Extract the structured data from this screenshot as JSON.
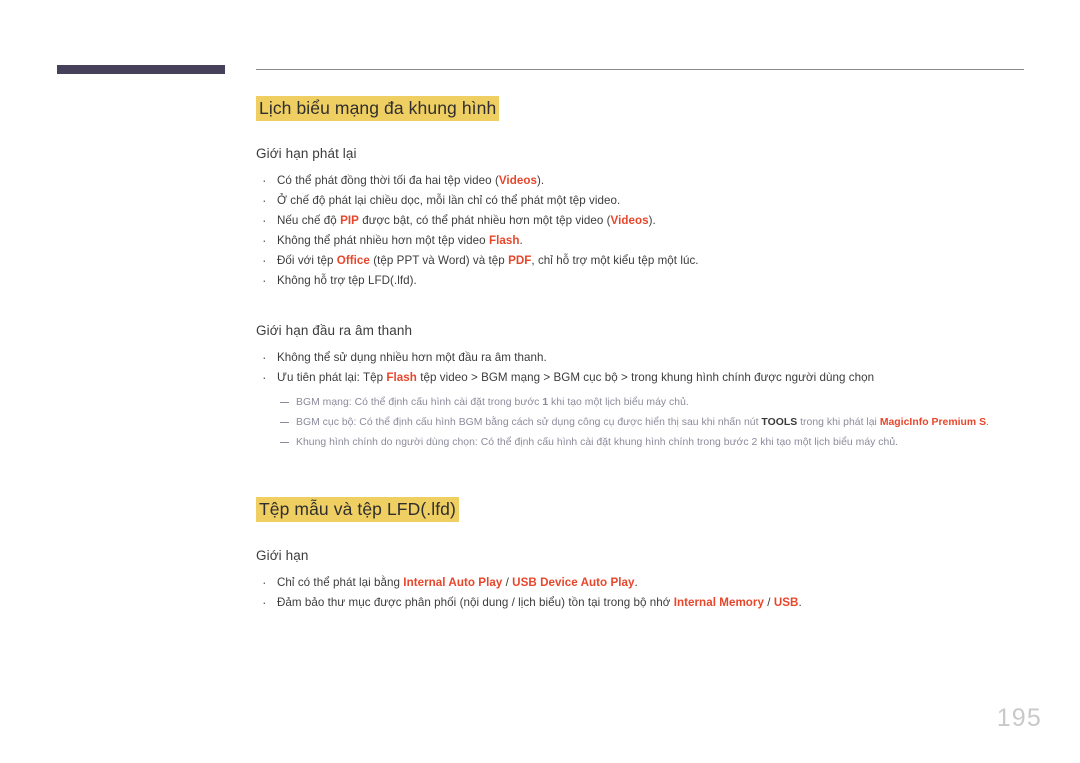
{
  "document": {
    "page_number": "195",
    "colors": {
      "highlight": "#efce62",
      "accent": "#e8462b",
      "header_bar": "#46405a",
      "note_text": "#8b8b9c",
      "page_number": "#c9c9c9"
    }
  },
  "sections": [
    {
      "heading": "Lịch biểu mạng đa khung hình",
      "subsections": [
        {
          "subheading": "Giới hạn phát lại",
          "bullets": [
            {
              "parts": [
                {
                  "text": "Có thể phát đồng thời tối đa hai tệp video (",
                  "style": "plain"
                },
                {
                  "text": "Videos",
                  "style": "accent"
                },
                {
                  "text": ").",
                  "style": "plain"
                }
              ]
            },
            {
              "parts": [
                {
                  "text": "Ở chế độ phát lại chiều dọc, mỗi lần chỉ có thể phát một tệp video.",
                  "style": "plain"
                }
              ]
            },
            {
              "parts": [
                {
                  "text": "Nếu chế độ ",
                  "style": "plain"
                },
                {
                  "text": "PIP",
                  "style": "accent"
                },
                {
                  "text": " được bật, có thể phát nhiều hơn một tệp video (",
                  "style": "plain"
                },
                {
                  "text": "Videos",
                  "style": "accent"
                },
                {
                  "text": ").",
                  "style": "plain"
                }
              ]
            },
            {
              "parts": [
                {
                  "text": "Không thể phát nhiều hơn một tệp video ",
                  "style": "plain"
                },
                {
                  "text": "Flash",
                  "style": "accent"
                },
                {
                  "text": ".",
                  "style": "plain"
                }
              ]
            },
            {
              "parts": [
                {
                  "text": "Đối với tệp ",
                  "style": "plain"
                },
                {
                  "text": "Office",
                  "style": "accent"
                },
                {
                  "text": " (tệp PPT và Word) và tệp ",
                  "style": "plain"
                },
                {
                  "text": "PDF",
                  "style": "accent"
                },
                {
                  "text": ", chỉ hỗ trợ một kiểu tệp một lúc.",
                  "style": "plain"
                }
              ]
            },
            {
              "parts": [
                {
                  "text": "Không hỗ trợ tệp LFD(.lfd).",
                  "style": "plain"
                }
              ]
            }
          ]
        },
        {
          "subheading": "Giới hạn đầu ra âm thanh",
          "bullets": [
            {
              "parts": [
                {
                  "text": "Không thể sử dụng nhiều hơn một đầu ra âm thanh.",
                  "style": "plain"
                }
              ]
            },
            {
              "parts": [
                {
                  "text": "Ưu tiên phát lại: Tệp ",
                  "style": "plain"
                },
                {
                  "text": "Flash",
                  "style": "accent"
                },
                {
                  "text": " tệp video > BGM mạng > BGM cục bộ > trong khung hình chính được người dùng chọn",
                  "style": "plain"
                }
              ]
            }
          ],
          "notes": [
            {
              "parts": [
                {
                  "text": "BGM mạng: Có thể định cấu hình cài đặt trong bước ",
                  "style": "note"
                },
                {
                  "text": "1",
                  "style": "note-bold"
                },
                {
                  "text": " khi tạo một lịch biểu máy chủ.",
                  "style": "note"
                }
              ]
            },
            {
              "parts": [
                {
                  "text": "BGM cục bộ: Có thể định cấu hình BGM bằng cách sử dụng công cụ được hiển thị sau khi nhấn nút ",
                  "style": "note"
                },
                {
                  "text": "TOOLS",
                  "style": "note-tools"
                },
                {
                  "text": " trong khi phát lại ",
                  "style": "note"
                },
                {
                  "text": "MagicInfo Premium S",
                  "style": "note-accent"
                },
                {
                  "text": ".",
                  "style": "note"
                }
              ]
            },
            {
              "parts": [
                {
                  "text": "Khung hình chính do người dùng chọn: Có thể định cấu hình cài đặt khung hình chính trong bước 2 khi tạo một lịch biểu máy chủ.",
                  "style": "note"
                }
              ]
            }
          ]
        }
      ]
    },
    {
      "heading": "Tệp mẫu và tệp LFD(.lfd)",
      "subsections": [
        {
          "subheading": "Giới hạn",
          "bullets": [
            {
              "parts": [
                {
                  "text": "Chỉ có thể phát lại bằng ",
                  "style": "plain"
                },
                {
                  "text": "Internal Auto Play",
                  "style": "accent"
                },
                {
                  "text": " / ",
                  "style": "plain"
                },
                {
                  "text": "USB Device Auto Play",
                  "style": "accent"
                },
                {
                  "text": ".",
                  "style": "plain"
                }
              ]
            },
            {
              "parts": [
                {
                  "text": "Đảm bảo thư mục được phân phối (nội dung / lịch biểu) tồn tại trong bộ nhớ ",
                  "style": "plain"
                },
                {
                  "text": "Internal Memory",
                  "style": "accent"
                },
                {
                  "text": " / ",
                  "style": "plain"
                },
                {
                  "text": "USB",
                  "style": "accent"
                },
                {
                  "text": ".",
                  "style": "plain"
                }
              ]
            }
          ]
        }
      ]
    }
  ]
}
